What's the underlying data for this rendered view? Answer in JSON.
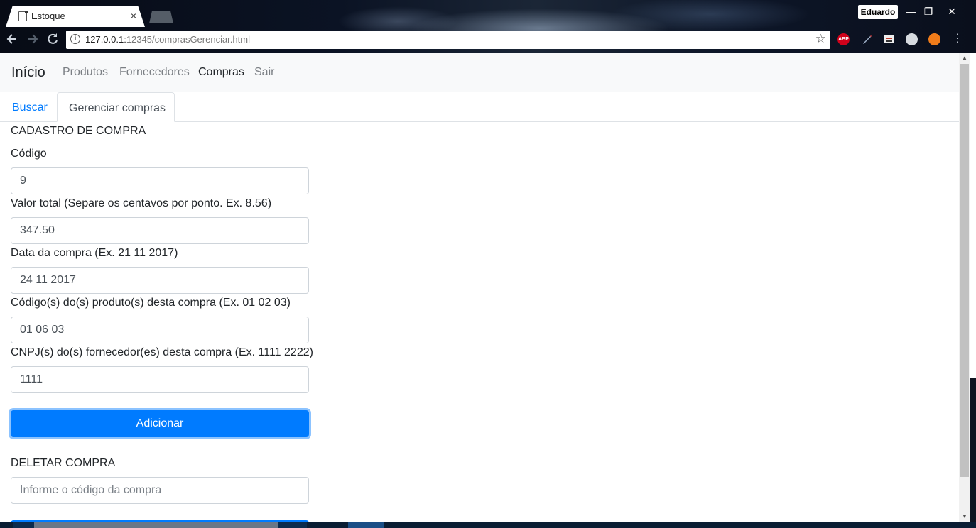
{
  "browser": {
    "tab_title": "Estoque",
    "tab_close": "×",
    "url_host": "127.0.0.1:",
    "url_rest": "12345/comprasGerenciar.html",
    "user_name": "Eduardo",
    "window_controls": {
      "minimize": "—",
      "restore": "❐",
      "close": "✕"
    },
    "icons": {
      "back": "back-arrow-icon",
      "forward": "forward-arrow-icon",
      "reload": "reload-icon",
      "info": "info-icon",
      "star": "bookmark-star-icon",
      "menu": "kebab-menu-icon"
    },
    "extensions": [
      {
        "name": "adblock-plus-icon",
        "label": "ABP",
        "color": "#d0021b"
      },
      {
        "name": "pen-extension-icon",
        "label": "",
        "color": "#3a3f47"
      },
      {
        "name": "reader-extension-icon",
        "label": "",
        "color": "#3a3f47"
      },
      {
        "name": "circle-extension-icon",
        "label": "",
        "color": "#bfc4ca"
      },
      {
        "name": "orange-extension-icon",
        "label": "",
        "color": "#f07c1a"
      }
    ]
  },
  "navbar": {
    "brand": "Início",
    "links": [
      {
        "label": "Produtos",
        "active": false
      },
      {
        "label": "Fornecedores",
        "active": false
      },
      {
        "label": "Compras",
        "active": true
      },
      {
        "label": "Sair",
        "active": false
      }
    ]
  },
  "tabs": {
    "buscar": "Buscar",
    "gerenciar": "Gerenciar compras"
  },
  "cadastro": {
    "title": "CADASTRO DE COMPRA",
    "fields": [
      {
        "label": "Código",
        "value": "9"
      },
      {
        "label": "Valor total (Separe os centavos por ponto. Ex. 8.56)",
        "value": "347.50"
      },
      {
        "label": "Data da compra (Ex. 21 11 2017)",
        "value": "24 11 2017"
      },
      {
        "label": "Código(s) do(s) produto(s) desta compra (Ex. 01 02 03)",
        "value": "01 06 03"
      },
      {
        "label": "CNPJ(s) do(s) fornecedor(es) desta compra (Ex. 1111 2222)",
        "value": "1111"
      }
    ],
    "submit_label": "Adicionar"
  },
  "deletar": {
    "title": "DELETAR COMPRA",
    "placeholder": "Informe o código da compra"
  },
  "colors": {
    "primary": "#007bff",
    "navbar_bg": "#f8f9fa",
    "text": "#212529",
    "muted_link": "#7b7f84"
  }
}
